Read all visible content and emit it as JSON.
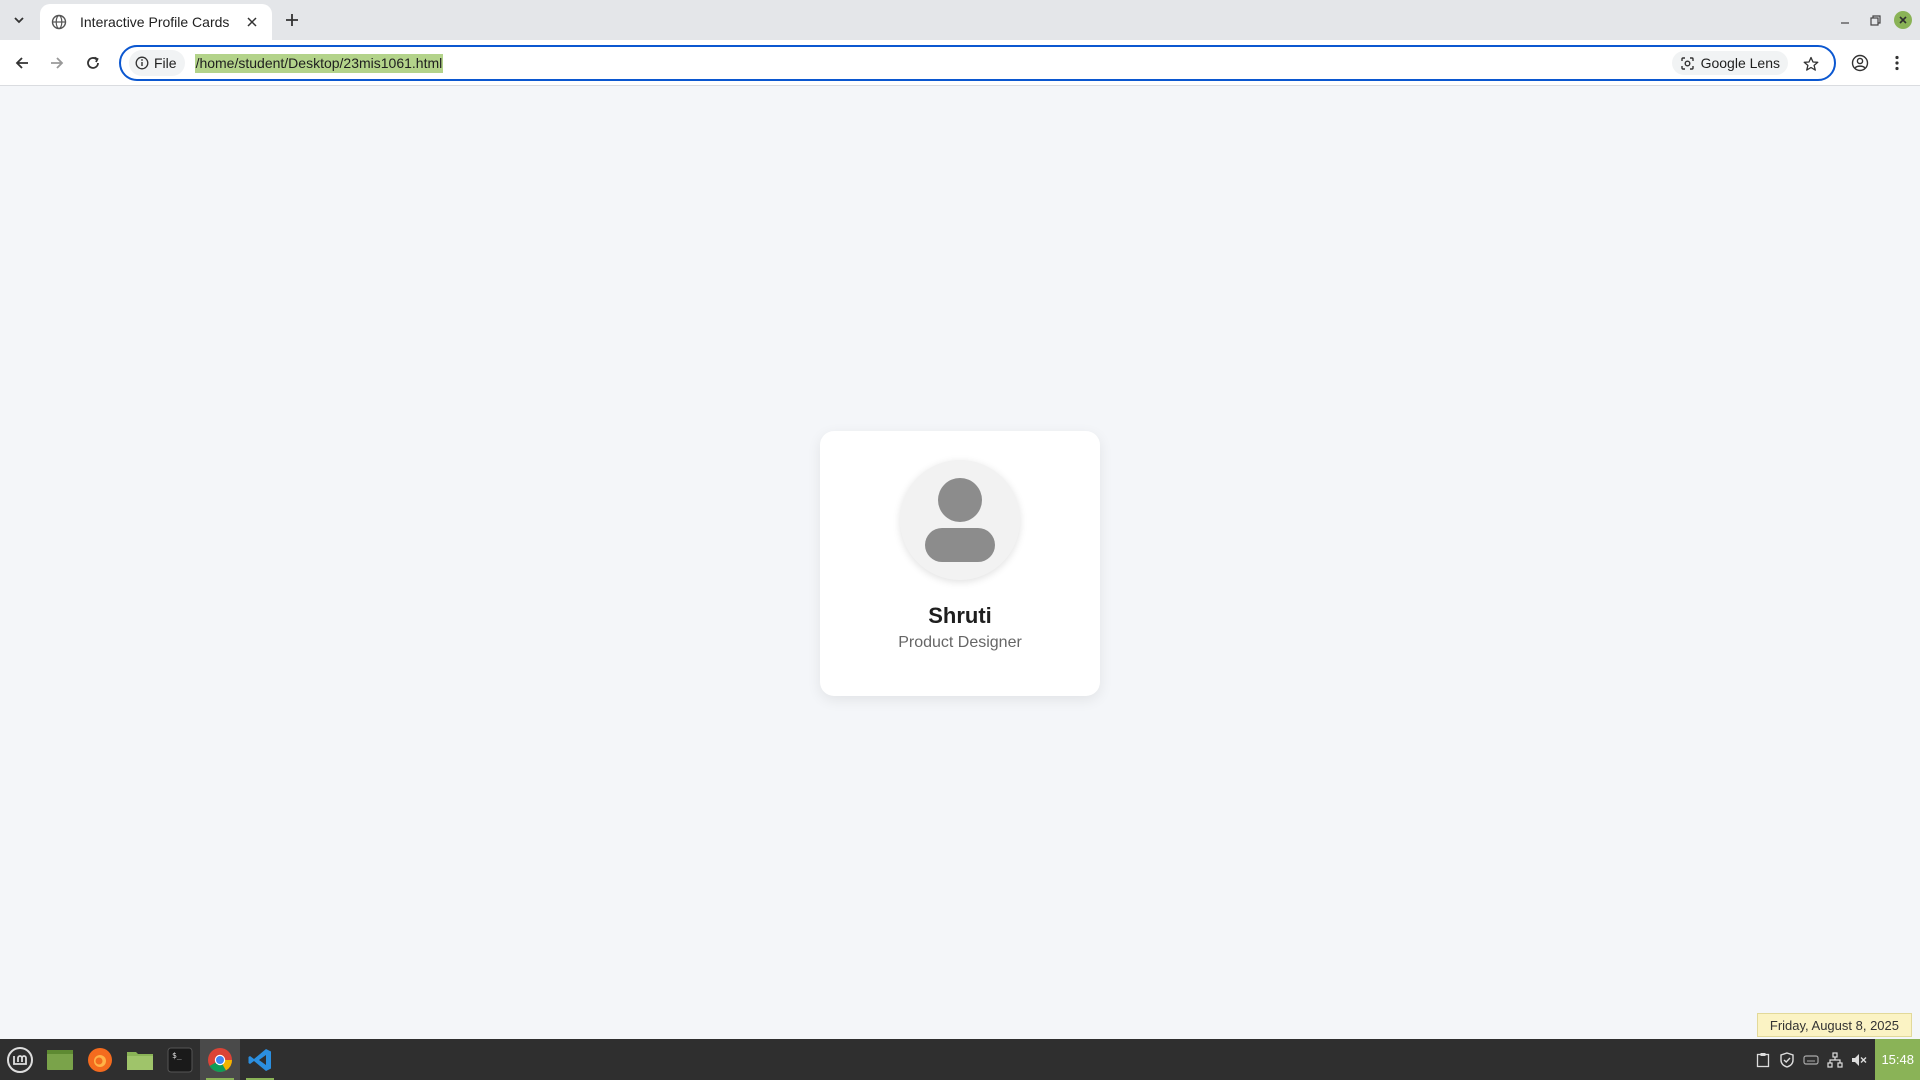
{
  "browser": {
    "tab_title": "Interactive Profile Cards",
    "site_info_label": "File",
    "url": "/home/student/Desktop/23mis1061.html",
    "lens_label": "Google Lens"
  },
  "card": {
    "name": "Shruti",
    "role": "Product Designer"
  },
  "system": {
    "date_tooltip": "Friday, August 8, 2025",
    "clock": "15:48"
  },
  "colors": {
    "accent": "#8ab357",
    "omnibox_border": "#0b57d0",
    "url_highlight": "#b3d38a",
    "page_bg": "#f4f6f9"
  },
  "icons": {
    "taskbar": [
      "mint-menu-icon",
      "show-desktop-icon",
      "firefox-icon",
      "files-icon",
      "terminal-icon",
      "chrome-icon",
      "vscode-icon"
    ],
    "tray": [
      "clipboard-icon",
      "shield-icon",
      "keyboard-icon",
      "network-icon",
      "volume-muted-icon"
    ]
  }
}
